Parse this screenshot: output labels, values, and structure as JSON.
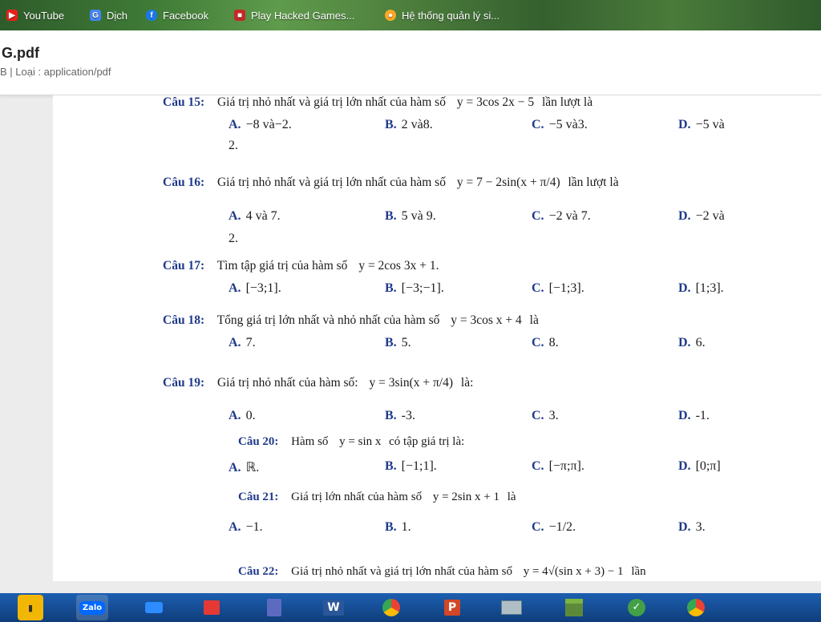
{
  "bookmarks": [
    {
      "label": "YouTube",
      "icon": "youtube-icon",
      "color": "#e62117",
      "glyph": "▶"
    },
    {
      "label": "Dịch",
      "icon": "translate-icon",
      "color": "#4285f4",
      "glyph": "G"
    },
    {
      "label": "Facebook",
      "icon": "facebook-icon",
      "color": "#1877f2",
      "glyph": "f"
    },
    {
      "label": "Play Hacked Games...",
      "icon": "game-icon",
      "color": "#c62828",
      "glyph": "■"
    },
    {
      "label": "Hệ thống quản lý si...",
      "icon": "school-icon",
      "color": "#f9a825",
      "glyph": "●"
    }
  ],
  "file": {
    "name": "G.pdf",
    "meta": "B | Loại : application/pdf"
  },
  "questions": [
    {
      "num": "Câu 15:",
      "text": "Giá trị nhỏ nhất và giá trị lớn nhất của hàm số",
      "math": "y = 3cos 2x − 5",
      "tail": "lần lượt là",
      "options": [
        {
          "label": "A.",
          "value": "−8 và−2."
        },
        {
          "label": "B.",
          "value": "2 và8."
        },
        {
          "label": "C.",
          "value": "−5 và3."
        },
        {
          "label": "D.",
          "value": "−5 và"
        }
      ],
      "wrap": "2."
    },
    {
      "num": "Câu 16:",
      "text": "Giá trị nhỏ nhất và giá trị lớn nhất của hàm số",
      "math": "y = 7 − 2sin(x + π/4)",
      "tail": "lần lượt là",
      "options": [
        {
          "label": "A.",
          "value": "4 và 7."
        },
        {
          "label": "B.",
          "value": "5 và 9."
        },
        {
          "label": "C.",
          "value": "−2 và 7."
        },
        {
          "label": "D.",
          "value": "−2 và"
        }
      ],
      "wrap": "2."
    },
    {
      "num": "Câu 17:",
      "text": "Tìm tập giá trị của hàm số",
      "math": "y = 2cos 3x + 1.",
      "tail": "",
      "options": [
        {
          "label": "A.",
          "value": "[−3;1]."
        },
        {
          "label": "B.",
          "value": "[−3;−1]."
        },
        {
          "label": "C.",
          "value": "[−1;3]."
        },
        {
          "label": "D.",
          "value": "[1;3]."
        }
      ]
    },
    {
      "num": "Câu 18:",
      "text": "Tổng giá trị lớn nhất và nhỏ nhất của hàm số",
      "math": "y = 3cos x + 4",
      "tail": "là",
      "options": [
        {
          "label": "A.",
          "value": "7."
        },
        {
          "label": "B.",
          "value": "5."
        },
        {
          "label": "C.",
          "value": "8."
        },
        {
          "label": "D.",
          "value": "6."
        }
      ]
    },
    {
      "num": "Câu 19:",
      "text": "Giá trị nhỏ nhất của hàm số:",
      "math": "y = 3sin(x + π/4)",
      "tail": "là:",
      "options": [
        {
          "label": "A.",
          "value": "0."
        },
        {
          "label": "B.",
          "value": "-3."
        },
        {
          "label": "C.",
          "value": "3."
        },
        {
          "label": "D.",
          "value": "-1."
        }
      ]
    },
    {
      "num": "Câu 20:",
      "text": "Hàm số",
      "math": "y = sin x",
      "tail": "có tập giá trị là:",
      "options": [
        {
          "label": "A.",
          "value": "ℝ."
        },
        {
          "label": "B.",
          "value": "[−1;1]."
        },
        {
          "label": "C.",
          "value": "[−π;π]."
        },
        {
          "label": "D.",
          "value": "[0;π]"
        }
      ]
    },
    {
      "num": "Câu 21:",
      "text": "Giá trị lớn nhất của hàm số",
      "math": "y = 2sin x + 1",
      "tail": "là",
      "options": [
        {
          "label": "A.",
          "value": "−1."
        },
        {
          "label": "B.",
          "value": "1."
        },
        {
          "label": "C.",
          "value": "−1/2."
        },
        {
          "label": "D.",
          "value": "3."
        }
      ]
    },
    {
      "num": "Câu 22:",
      "text": "Giá trị nhỏ nhất và giá trị lớn nhất của hàm số",
      "math": "y = 4√(sin x + 3) − 1",
      "tail": "lần",
      "options": []
    }
  ],
  "taskbar": [
    {
      "name": "file-explorer-icon",
      "glyph": "▮",
      "color": "#f2b705"
    },
    {
      "name": "zalo-icon",
      "glyph": "Zalo",
      "color": "#0068ff"
    },
    {
      "name": "zoom-icon",
      "glyph": "■",
      "color": "#2d8cff"
    },
    {
      "name": "app-icon",
      "glyph": "▦",
      "color": "#e53935"
    },
    {
      "name": "calculator-icon",
      "glyph": "▤",
      "color": "#5c6bc0"
    },
    {
      "name": "word-icon",
      "glyph": "W",
      "color": "#2b579a"
    },
    {
      "name": "chrome-icon",
      "glyph": "◉",
      "color": "#34a853"
    },
    {
      "name": "powerpoint-icon",
      "glyph": "P",
      "color": "#d24726"
    },
    {
      "name": "window-icon",
      "glyph": "▭",
      "color": "#607d8b"
    },
    {
      "name": "minecraft-icon",
      "glyph": "▩",
      "color": "#5d8a3a"
    },
    {
      "name": "coccoc-icon",
      "glyph": "✓",
      "color": "#43a047"
    },
    {
      "name": "chrome-profile-icon",
      "glyph": "◉",
      "color": "#34a853"
    }
  ]
}
